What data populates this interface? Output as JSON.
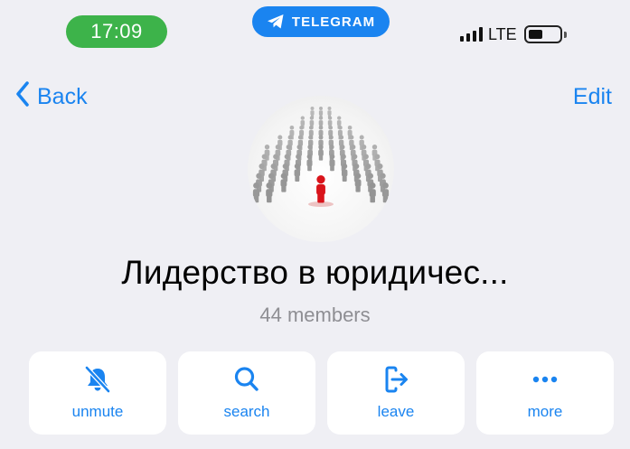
{
  "status_bar": {
    "time": "17:09",
    "app_name": "TELEGRAM",
    "app_icon": "telegram-plane-icon",
    "network": "LTE",
    "battery_level": 0.35
  },
  "nav": {
    "back_label": "Back",
    "edit_label": "Edit"
  },
  "group": {
    "title": "Лидерство в юридичес...",
    "members": "44 members",
    "avatar": "crowd-leader-image"
  },
  "actions": [
    {
      "label": "unmute",
      "icon": "bell-slash-icon"
    },
    {
      "label": "search",
      "icon": "search-icon"
    },
    {
      "label": "leave",
      "icon": "leave-icon"
    },
    {
      "label": "more",
      "icon": "more-icon"
    }
  ],
  "colors": {
    "accent": "#1a84f0",
    "time_pill": "#3db34a",
    "background": "#efeff4",
    "secondary_text": "#8e8e93"
  }
}
